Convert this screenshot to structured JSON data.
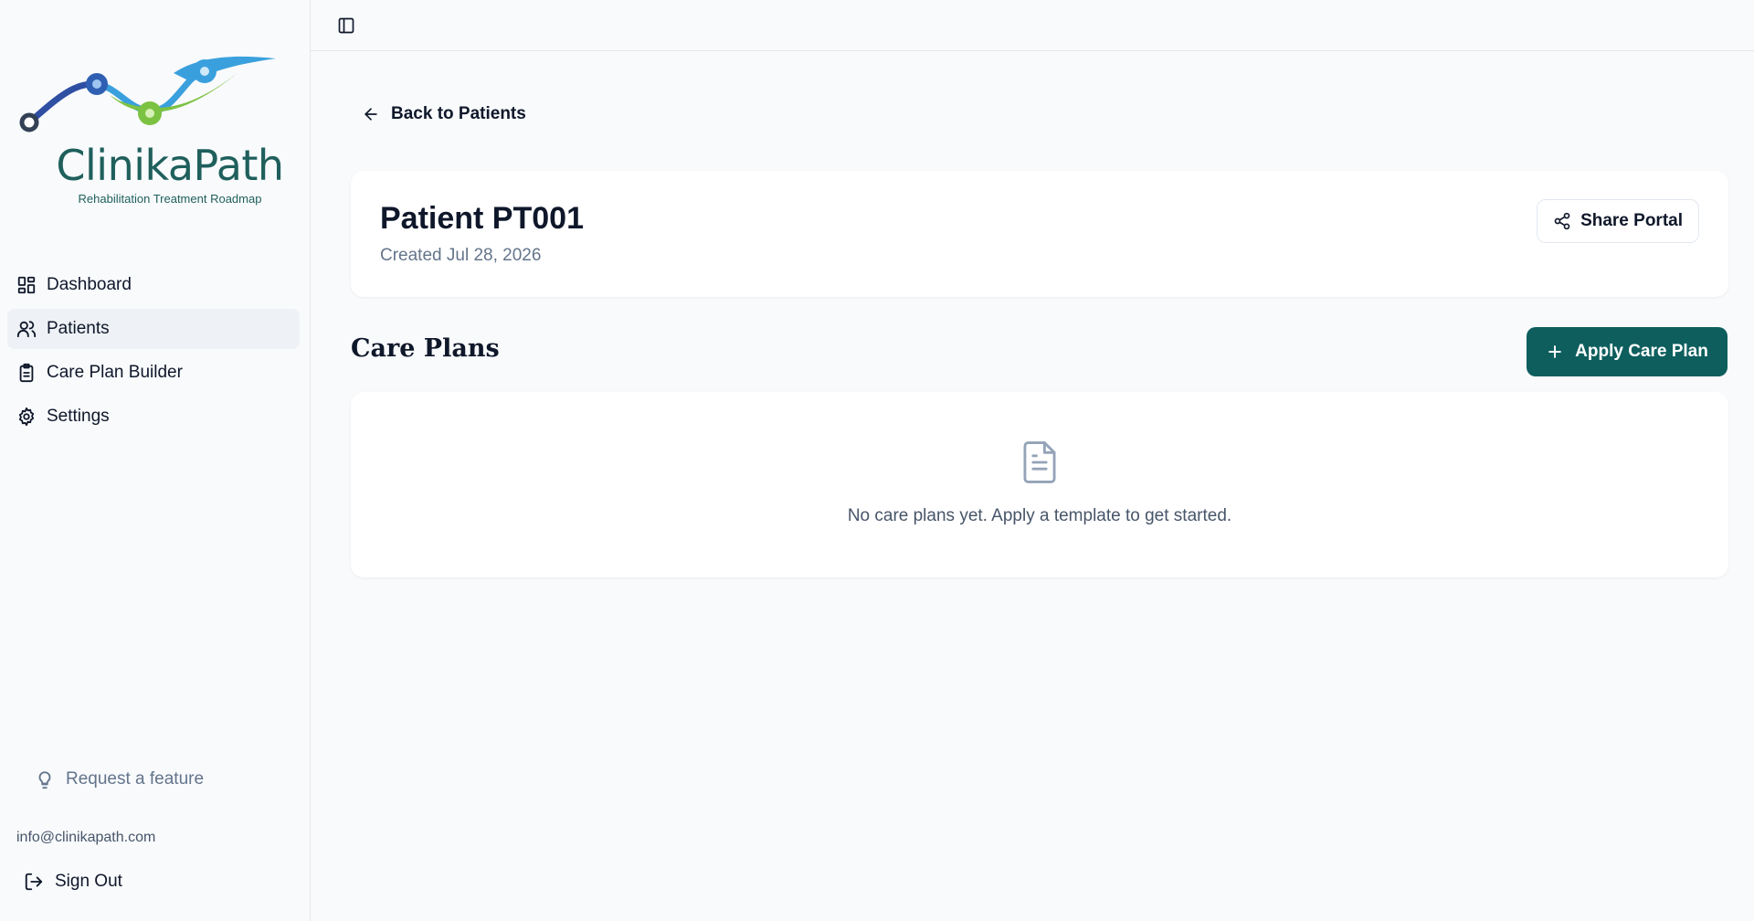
{
  "brand": {
    "name": "ClinikaPath",
    "tagline": "Rehabilitation Treatment Roadmap",
    "colors": {
      "teal": "#1f5f5c",
      "blue": "#2f5fb3",
      "green": "#7cc242",
      "sky": "#3aa0dd"
    }
  },
  "sidebar": {
    "items": [
      {
        "label": "Dashboard",
        "icon": "dashboard-grid-icon",
        "active": false
      },
      {
        "label": "Patients",
        "icon": "users-icon",
        "active": true
      },
      {
        "label": "Care Plan Builder",
        "icon": "clipboard-icon",
        "active": false
      },
      {
        "label": "Settings",
        "icon": "gear-icon",
        "active": false
      }
    ],
    "request_feature": "Request a feature",
    "email": "info@clinikapath.com",
    "sign_out": "Sign Out"
  },
  "main": {
    "back_label": "Back to Patients",
    "patient": {
      "title": "Patient PT001",
      "created": "Created Jul 28, 2026",
      "share_label": "Share Portal"
    },
    "care_plans": {
      "title": "Care Plans",
      "apply_label": "Apply Care Plan",
      "empty_message": "No care plans yet. Apply a template to get started."
    }
  },
  "colors": {
    "primary": "#0e5e5e",
    "background": "#f8fafc",
    "active_nav": "#eef2f6",
    "muted_text": "#64748b"
  }
}
